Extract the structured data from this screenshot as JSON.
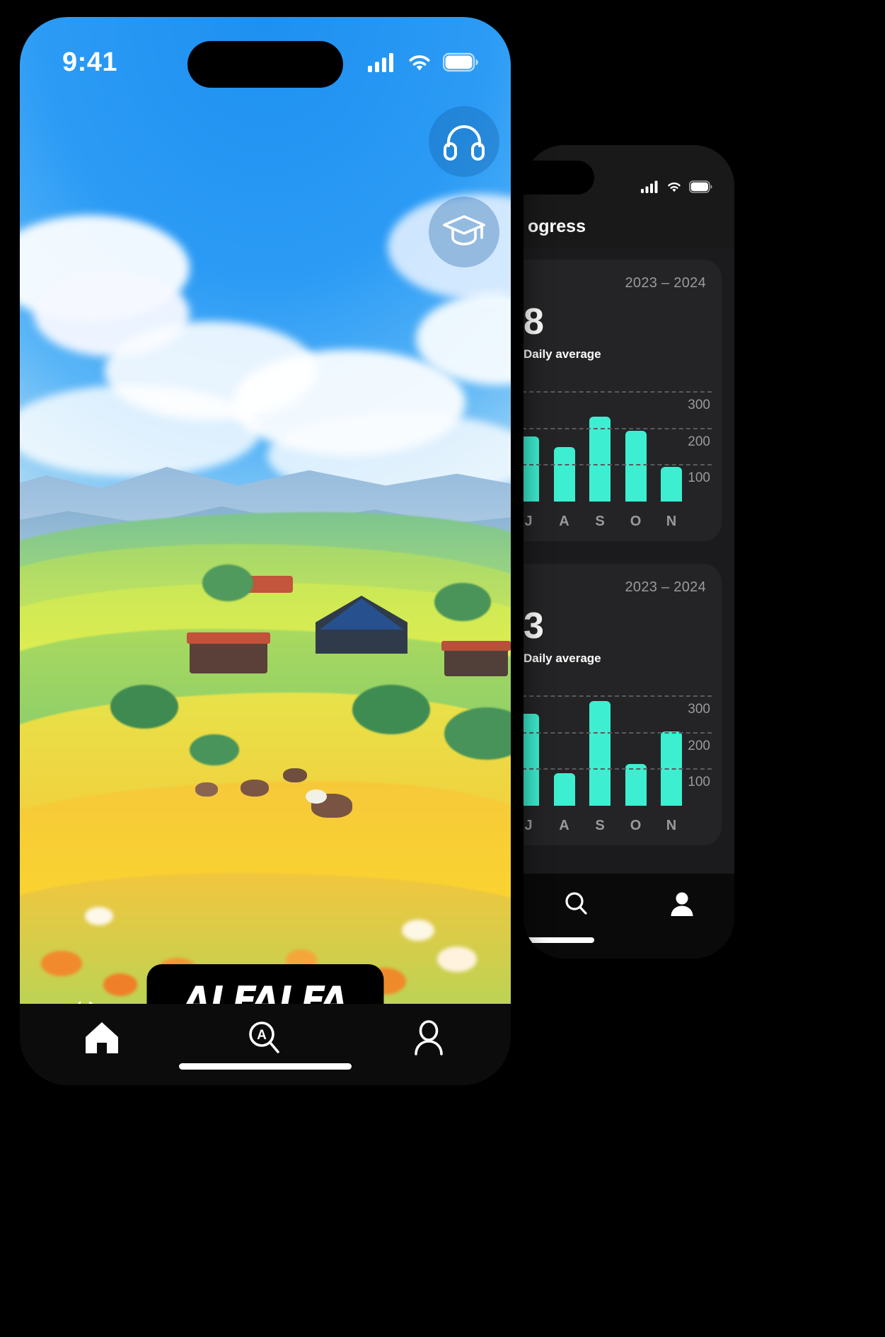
{
  "phone_front": {
    "status_bar": {
      "time": "9:41",
      "icons": [
        "cellular-signal-icon",
        "wifi-icon",
        "battery-icon"
      ]
    },
    "floating_buttons": [
      {
        "name": "headphones-button",
        "icon": "headphones-icon"
      },
      {
        "name": "learn-button",
        "icon": "graduation-cap-icon"
      }
    ],
    "brand_label": "ALFALFA",
    "audio_button": {
      "icon": "speaker-wave-icon"
    },
    "tab_bar": [
      {
        "label": "home-tab",
        "icon": "home-icon",
        "active": true
      },
      {
        "label": "search-tab",
        "icon": "search-a-icon",
        "active": false
      },
      {
        "label": "profile-tab",
        "icon": "person-icon",
        "active": false
      }
    ]
  },
  "phone_back": {
    "status_bar": {
      "icons": [
        "cellular-signal-icon",
        "wifi-icon",
        "battery-icon"
      ]
    },
    "header_title": "ogress",
    "tab_bar": [
      {
        "label": "search-tab",
        "icon": "search-icon"
      },
      {
        "label": "profile-tab",
        "icon": "person-filled-icon"
      }
    ],
    "cards": [
      {
        "year_range": "2023 – 2024",
        "big_value": "8",
        "subtitle": "Daily average"
      },
      {
        "year_range": "2023 – 2024",
        "big_value": "3",
        "subtitle": "Daily average"
      }
    ]
  },
  "colors": {
    "accent_bar": "#3DEFD0",
    "card_bg": "#242426",
    "screen_bg": "#1b1b1d",
    "gridline": "#5a5a5e",
    "muted_text": "#9a9a9e",
    "sky_blue": "#1e90f0",
    "brand_black": "#000000"
  },
  "chart_data": [
    {
      "type": "bar",
      "title": "Daily average",
      "subtitle": "2023 – 2024",
      "annotation": "8",
      "categories": [
        "J",
        "A",
        "S",
        "O",
        "N"
      ],
      "values": [
        180,
        150,
        235,
        195,
        95
      ],
      "xlabel": "",
      "ylabel": "",
      "ylim": [
        0,
        340
      ],
      "yticks": [
        100,
        200,
        300
      ],
      "ytick_labels": [
        "100",
        "200",
        "300"
      ],
      "grid": true,
      "grid_style": "dashed-horizontal",
      "legend": "none",
      "bar_color": "#3DEFD0"
    },
    {
      "type": "bar",
      "title": "Daily average",
      "subtitle": "2023 – 2024",
      "annotation": "3",
      "categories": [
        "J",
        "A",
        "S",
        "O",
        "N"
      ],
      "values": [
        255,
        90,
        290,
        115,
        205
      ],
      "xlabel": "",
      "ylabel": "",
      "ylim": [
        0,
        340
      ],
      "yticks": [
        100,
        200,
        300
      ],
      "ytick_labels": [
        "100",
        "200",
        "300"
      ],
      "grid": true,
      "grid_style": "dashed-horizontal",
      "legend": "none",
      "bar_color": "#3DEFD0"
    }
  ]
}
